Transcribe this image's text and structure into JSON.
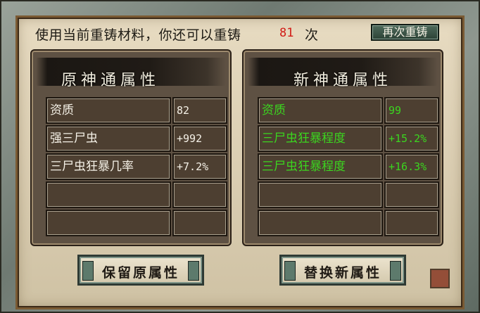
{
  "header": {
    "prompt": "使用当前重铸材料，你还可以重铸",
    "remaining_count": "81",
    "suffix": "次",
    "reforge_again_label": "再次重铸"
  },
  "original": {
    "title": "原神通属性",
    "rows": [
      {
        "name": "资质",
        "value": "82"
      },
      {
        "name": "强三尸虫",
        "value": "+992"
      },
      {
        "name": "三尸虫狂暴几率",
        "value": "+7.2%"
      },
      {
        "name": "",
        "value": ""
      },
      {
        "name": "",
        "value": ""
      }
    ]
  },
  "new": {
    "title": "新神通属性",
    "rows": [
      {
        "name": "资质",
        "value": "99"
      },
      {
        "name": "三尸虫狂暴程度",
        "value": "+15.2%"
      },
      {
        "name": "三尸虫狂暴程度",
        "value": "+16.3%"
      },
      {
        "name": "",
        "value": ""
      },
      {
        "name": "",
        "value": ""
      }
    ]
  },
  "buttons": {
    "keep_label": "保留原属性",
    "replace_label": "替换新属性"
  },
  "colors": {
    "count_red": "#d11b16",
    "new_attr_green": "#3bd51f"
  }
}
